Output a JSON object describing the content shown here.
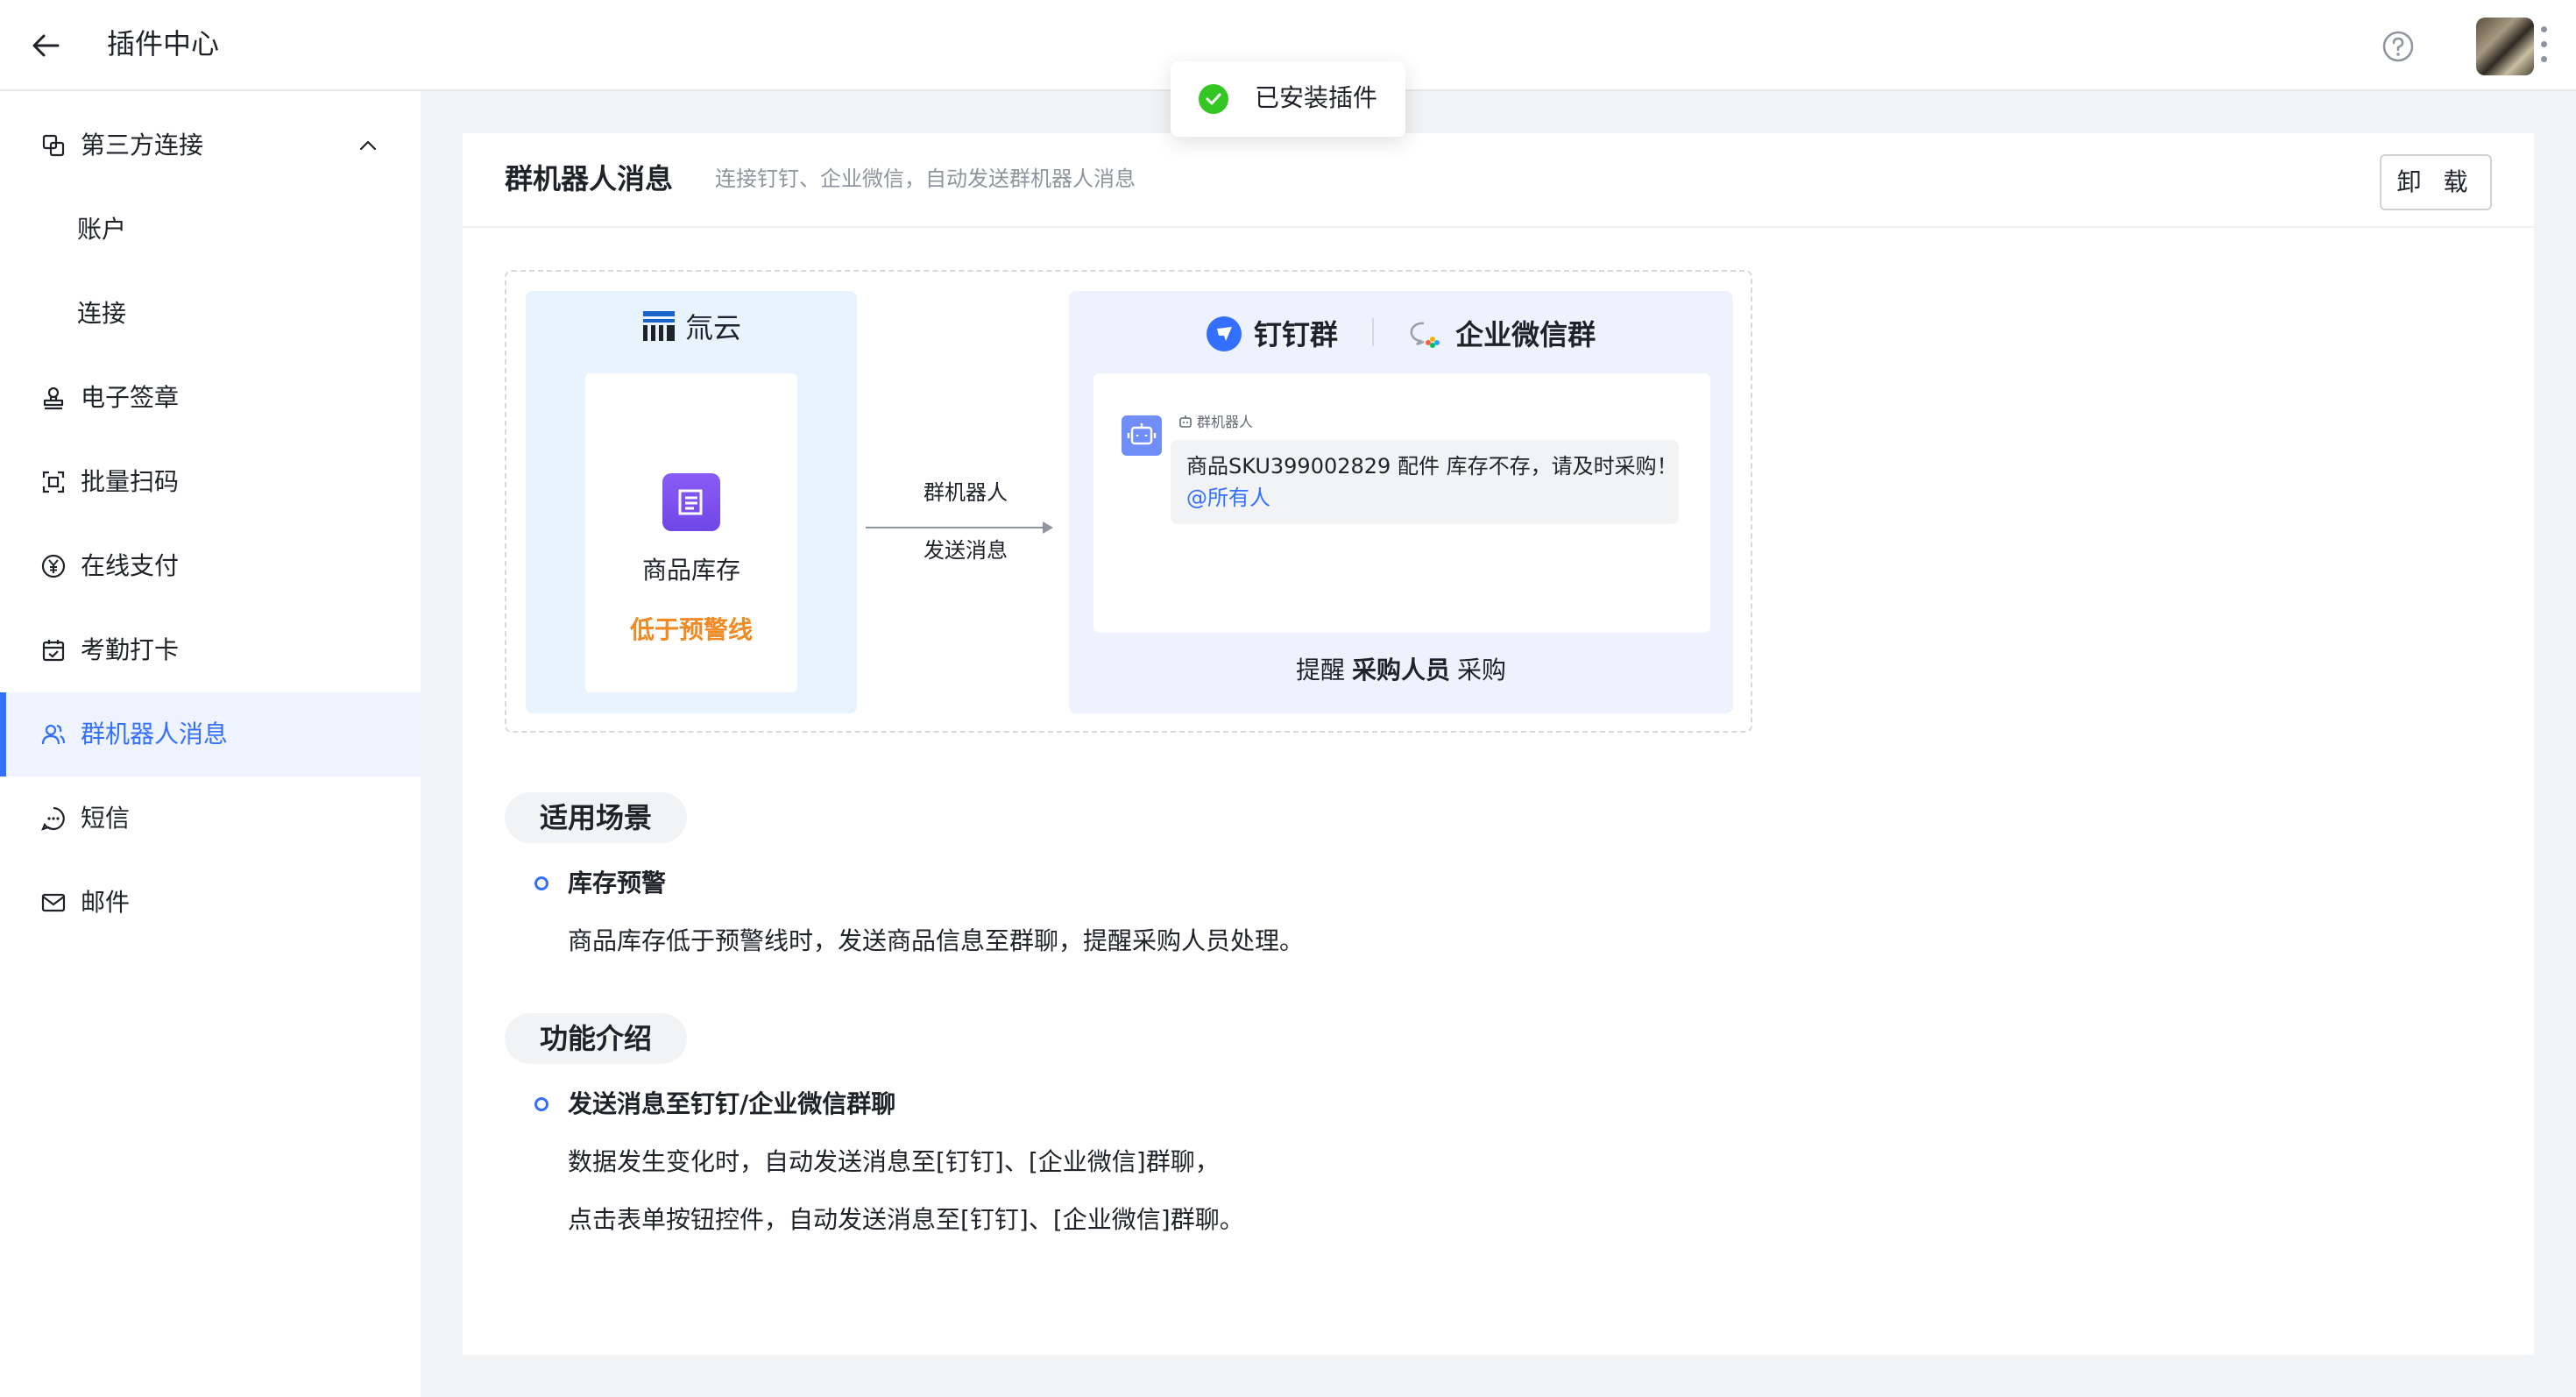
{
  "header": {
    "title": "插件中心"
  },
  "sidebar": {
    "group_label": "第三方连接",
    "items": [
      {
        "label": "账户"
      },
      {
        "label": "连接"
      },
      {
        "label": "电子签章"
      },
      {
        "label": "批量扫码"
      },
      {
        "label": "在线支付"
      },
      {
        "label": "考勤打卡"
      },
      {
        "label": "群机器人消息"
      },
      {
        "label": "短信"
      },
      {
        "label": "邮件"
      }
    ],
    "active_item": "群机器人消息"
  },
  "plugin": {
    "title": "群机器人消息",
    "description": "连接钉钉、企业微信，自动发送群机器人消息",
    "uninstall_label": "卸 载"
  },
  "diagram": {
    "source_brand": "氚云",
    "source_item": "商品库存",
    "source_condition": "低于预警线",
    "arrow_line1": "群机器人",
    "arrow_line2": "发送消息",
    "dest_dingtalk": "钉钉群",
    "dest_wecom": "企业微信群",
    "bot_name": "群机器人",
    "message_text": "商品SKU399002829  配件 库存不存，请及时采购！",
    "message_mention": "@所有人",
    "remind_prefix": "提醒",
    "remind_role": "采购人员",
    "remind_action": "采购"
  },
  "scenario": {
    "section_title": "适用场景",
    "item_title": "库存预警",
    "item_body": "商品库存低于预警线时，发送商品信息至群聊，提醒采购人员处理。"
  },
  "features": {
    "section_title": "功能介绍",
    "item_title": "发送消息至钉钉/企业微信群聊",
    "line1": "数据发生变化时，自动发送消息至[钉钉]、[企业微信]群聊，",
    "line2": "点击表单按钮控件，自动发送消息至[钉钉]、[企业微信]群聊。"
  },
  "toast": {
    "text": "已安装插件"
  },
  "colors": {
    "accent": "#3370ff",
    "warning": "#f08a24",
    "success": "#34c724"
  }
}
